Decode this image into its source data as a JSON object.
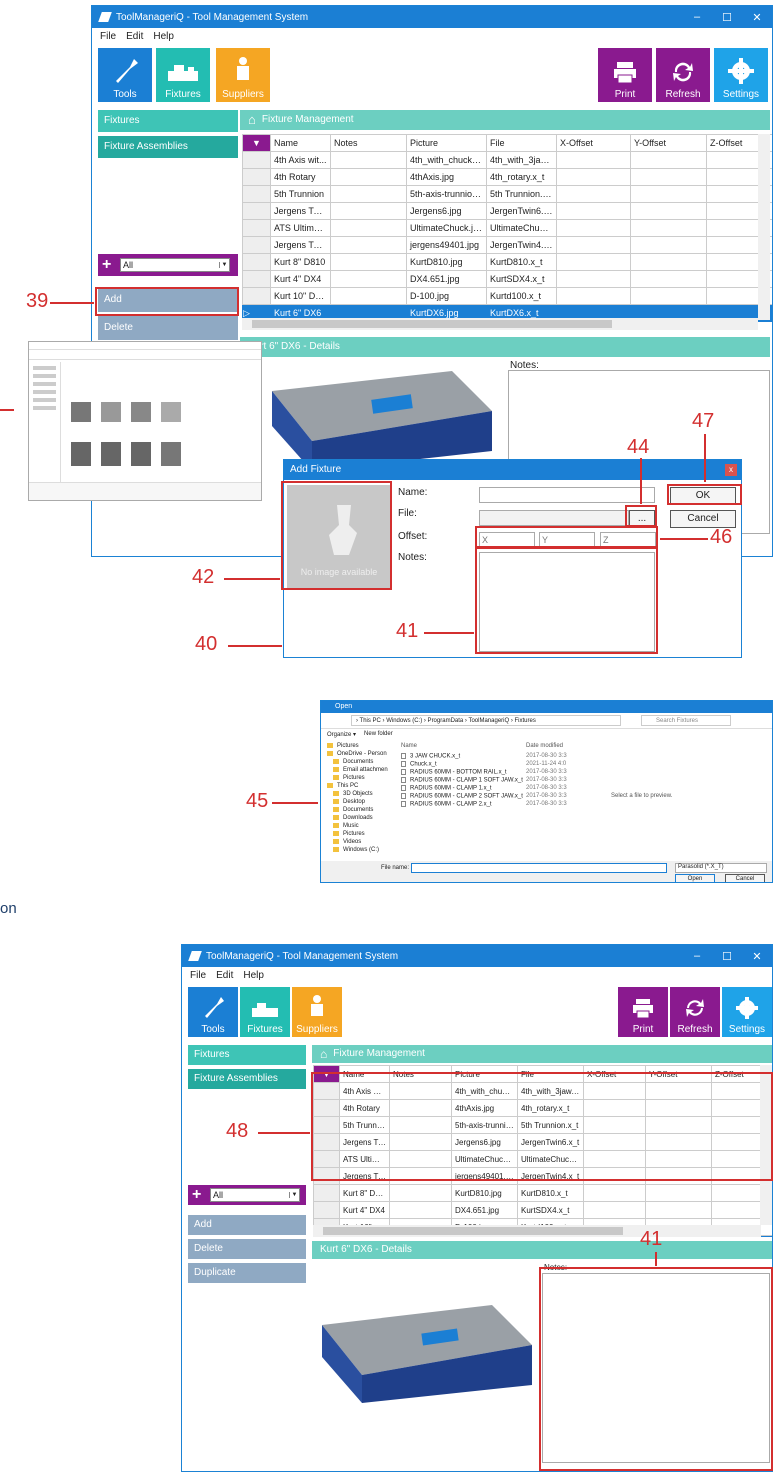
{
  "app": {
    "title": "ToolManageriQ - Tool Management System",
    "menu": [
      "File",
      "Edit",
      "Help"
    ],
    "toolbar": {
      "tools": "Tools",
      "fixtures": "Fixtures",
      "suppliers": "Suppliers",
      "print": "Print",
      "refresh": "Refresh",
      "settings": "Settings"
    },
    "sidebar": {
      "items": [
        "Fixtures",
        "Fixture Assemblies"
      ],
      "filter_value": "All",
      "buttons": [
        "Add",
        "Delete",
        "Duplicate"
      ]
    },
    "section_title": "Fixture Management",
    "columns": [
      "Name",
      "Notes",
      "Picture",
      "File",
      "X-Offset",
      "Y-Offset",
      "Z-Offset"
    ],
    "rows": [
      [
        "4th Axis wit...",
        "",
        "4th_with_chuck.j...",
        "4th_with_3jaw.x_t"
      ],
      [
        "4th Rotary",
        "",
        "4thAxis.jpg",
        "4th_rotary.x_t"
      ],
      [
        "5th Trunnion",
        "",
        "5th-axis-trunnion.j...",
        "5th Trunnion.x_t"
      ],
      [
        "Jergens Twi...",
        "",
        "Jergens6.jpg",
        "JergenTwin6.x_t"
      ],
      [
        "ATS Ultimat...",
        "",
        "UltimateChuck.jpg",
        "UltimateChuck.x_t"
      ],
      [
        "Jergens Twi...",
        "",
        "jergens49401.jpg",
        "JergenTwin4.x_t"
      ],
      [
        "Kurt 8\" D810",
        "",
        "KurtD810.jpg",
        "KurtD810.x_t"
      ],
      [
        "Kurt 4\" DX4",
        "",
        "DX4.651.jpg",
        "KurtSDX4.x_t"
      ],
      [
        "Kurt 10\" D1...",
        "",
        "D-100.jpg",
        "Kurtd100.x_t"
      ],
      [
        "Kurt 6\" DX6",
        "",
        "KurtDX6.jpg",
        "KurtDX6.x_t"
      ]
    ],
    "selected_row": 9,
    "details_title": "Kurt 6\" DX6 - Details",
    "notes_label": "Notes:",
    "window_controls": [
      "–",
      "☐",
      "✕"
    ]
  },
  "dialog": {
    "title": "Add Fixture",
    "close": "x",
    "no_image": "No image available",
    "name_label": "Name:",
    "file_label": "File:",
    "offset_label": "Offset:",
    "notes_label": "Notes:",
    "browse": "...",
    "x_ph": "X",
    "y_ph": "Y",
    "z_ph": "Z",
    "ok": "OK",
    "cancel": "Cancel"
  },
  "open_dialog": {
    "title": "Open",
    "path": "› This PC › Windows (C:) › ProgramData › ToolManageriQ › Fixtures",
    "search_ph": "Search Fixtures",
    "organize": "Organize ▾",
    "new_folder": "New folder",
    "nav": [
      "Pictures",
      "OneDrive - Person",
      "Documents",
      "Email attachmen",
      "Pictures",
      "This PC",
      "3D Objects",
      "Desktop",
      "Documents",
      "Downloads",
      "Music",
      "Pictures",
      "Videos",
      "Windows (C:)"
    ],
    "col_name": "Name",
    "col_date": "Date modified",
    "files": [
      [
        "3 JAW CHUCK.x_t",
        "2017-08-30 3:3"
      ],
      [
        "Chuck.x_t",
        "2021-11-24 4:0"
      ],
      [
        "RADIUS 60MM - BOTTOM RAIL.x_t",
        "2017-08-30 3:3"
      ],
      [
        "RADIUS 60MM - CLAMP 1 SOFT JAW.x_t",
        "2017-08-30 3:3"
      ],
      [
        "RADIUS 60MM - CLAMP 1.x_t",
        "2017-08-30 3:3"
      ],
      [
        "RADIUS 60MM - CLAMP 2 SOFT JAW.x_t",
        "2017-08-30 3:3"
      ],
      [
        "RADIUS 60MM - CLAMP 2.x_t",
        "2017-08-30 3:3"
      ]
    ],
    "preview": "Select a file to preview.",
    "filename_label": "File name:",
    "filetype": "Parasolid (*.X_T)",
    "open": "Open",
    "cancel": "Cancel"
  },
  "callouts": [
    "39",
    "40",
    "41",
    "42",
    "44",
    "45",
    "46",
    "47",
    "48",
    "41"
  ],
  "edge_text": "on"
}
